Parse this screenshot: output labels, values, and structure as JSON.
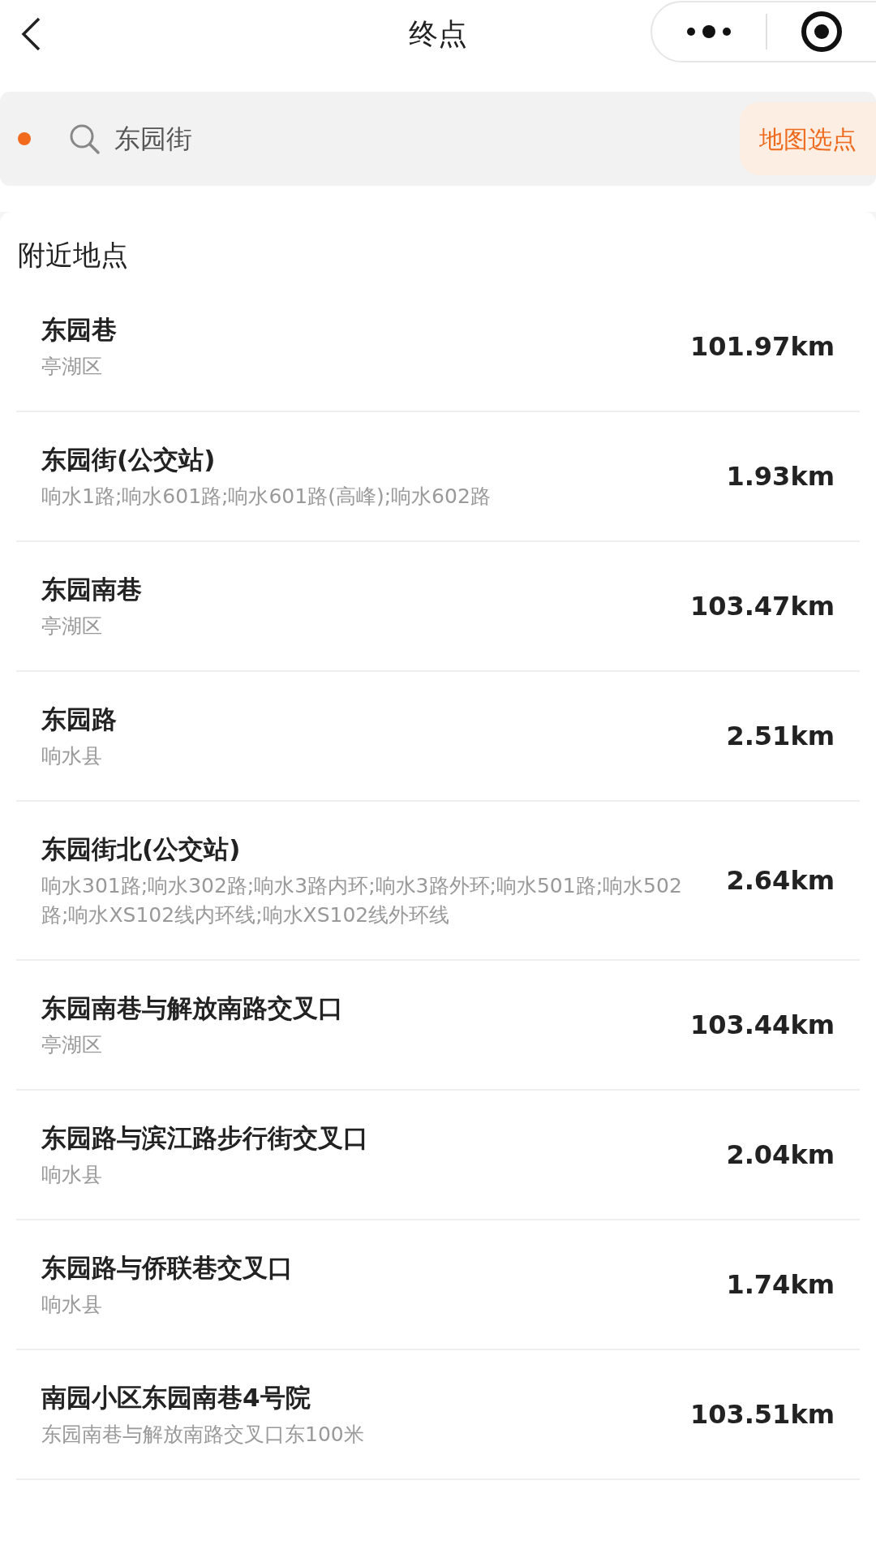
{
  "header": {
    "title": "终点"
  },
  "search": {
    "value": "东园街",
    "map_button": "地图选点"
  },
  "nearby": {
    "heading": "附近地点",
    "items": [
      {
        "name": "东园巷",
        "detail": "亭湖区",
        "distance": "101.97km"
      },
      {
        "name": "东园街(公交站)",
        "detail": "响水1路;响水601路;响水601路(高峰);响水602路",
        "distance": "1.93km"
      },
      {
        "name": "东园南巷",
        "detail": "亭湖区",
        "distance": "103.47km"
      },
      {
        "name": "东园路",
        "detail": "响水县",
        "distance": "2.51km"
      },
      {
        "name": "东园街北(公交站)",
        "detail": "响水301路;响水302路;响水3路内环;响水3路外环;响水501路;响水502路;响水XS102线内环线;响水XS102线外环线",
        "distance": "2.64km"
      },
      {
        "name": "东园南巷与解放南路交叉口",
        "detail": "亭湖区",
        "distance": "103.44km"
      },
      {
        "name": "东园路与滨江路步行街交叉口",
        "detail": "响水县",
        "distance": "2.04km"
      },
      {
        "name": "东园路与侨联巷交叉口",
        "detail": "响水县",
        "distance": "1.74km"
      },
      {
        "name": "南园小区东园南巷4号院",
        "detail": "东园南巷与解放南路交叉口东100米",
        "distance": "103.51km"
      }
    ]
  }
}
